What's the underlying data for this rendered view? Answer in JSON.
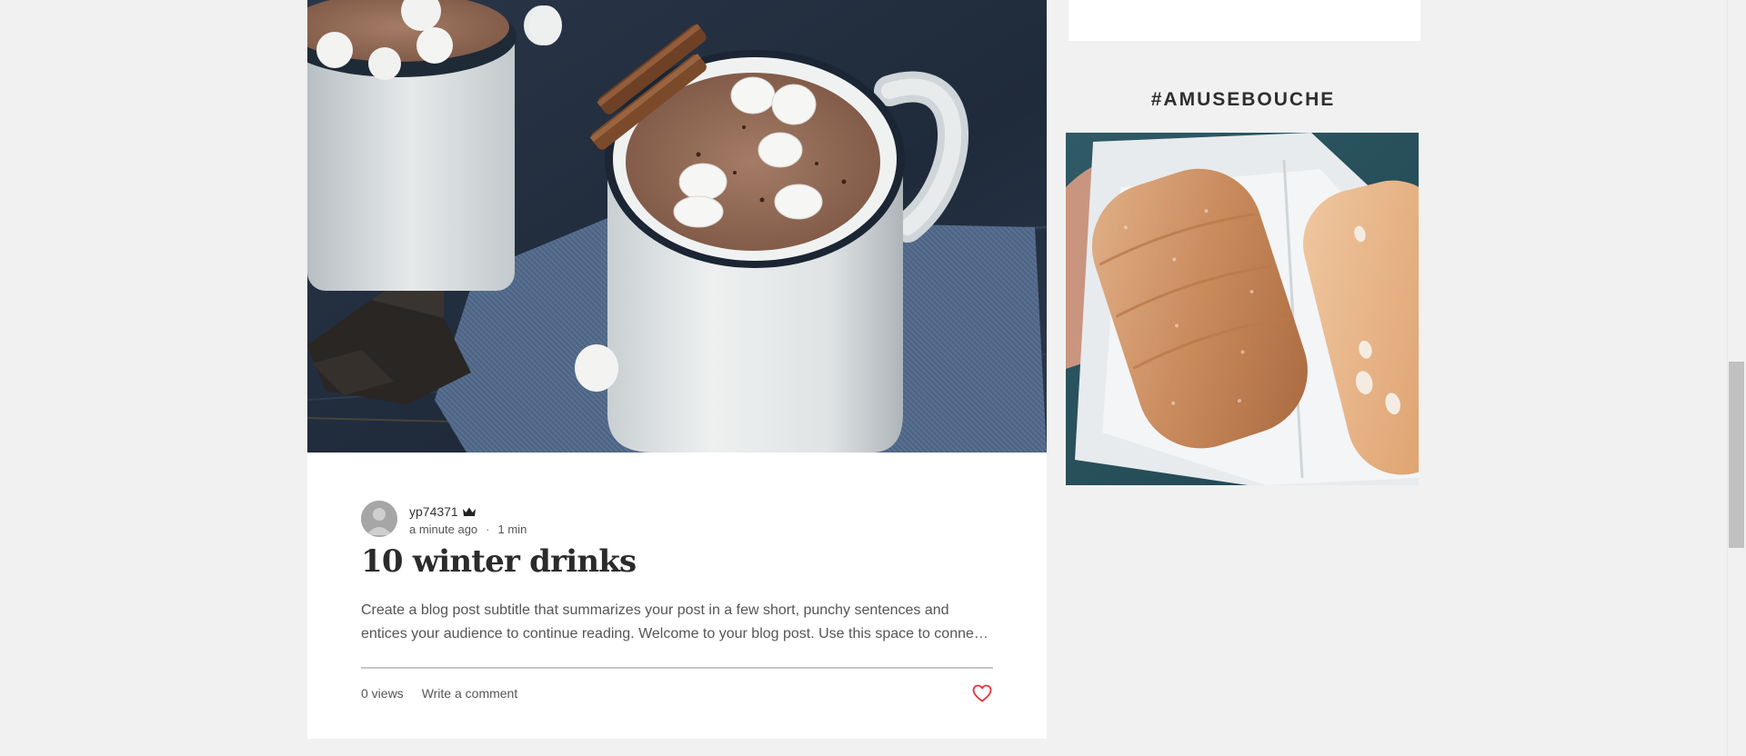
{
  "post": {
    "author": {
      "name": "yp74371"
    },
    "published": "a minute ago",
    "separator": "·",
    "read_time": "1 min",
    "title": "10 winter drinks",
    "excerpt": "Create a blog post subtitle that summarizes your post in a few short, punchy sentences and entices your audience to continue reading. Welcome to your blog post. Use this space to connect with your readers and potential customers in a way that's current and interesting.",
    "views": "0 views",
    "comment_label": "Write a comment",
    "like_color": "#e8303e"
  },
  "sidebar": {
    "heading": "#AMUSEBOUCHE"
  },
  "icons": {
    "crown": "crown-icon",
    "heart": "heart-outline-icon",
    "avatar": "user-silhouette-icon"
  }
}
